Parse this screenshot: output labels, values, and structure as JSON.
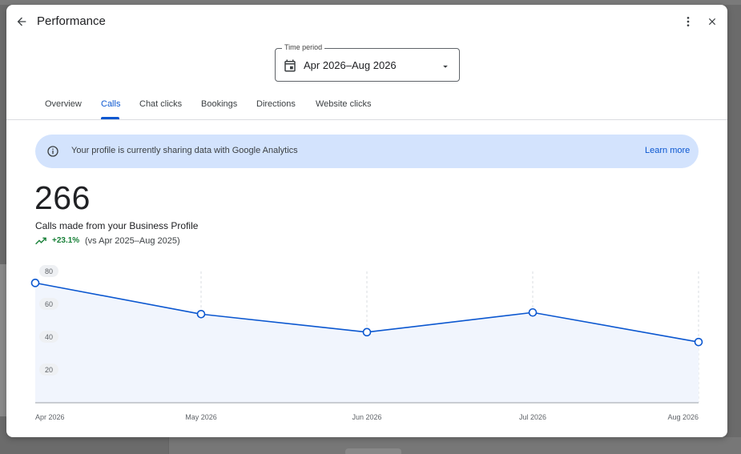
{
  "header": {
    "title": "Performance"
  },
  "time_period": {
    "label": "Time period",
    "value": "Apr 2026–Aug 2026"
  },
  "tabs": [
    {
      "label": "Overview",
      "active": false
    },
    {
      "label": "Calls",
      "active": true
    },
    {
      "label": "Chat clicks",
      "active": false
    },
    {
      "label": "Bookings",
      "active": false
    },
    {
      "label": "Directions",
      "active": false
    },
    {
      "label": "Website clicks",
      "active": false
    }
  ],
  "banner": {
    "text": "Your profile is currently sharing data with Google Analytics",
    "link": "Learn more"
  },
  "metric": {
    "value": "266",
    "description": "Calls made from your Business Profile",
    "change": "+23.1%",
    "comparison": "(vs Apr 2025–Aug 2025)"
  },
  "colors": {
    "accent": "#0b57d0",
    "banner_bg": "#d3e3fd",
    "positive": "#188038",
    "area_fill": "#f1f5fd"
  },
  "chart_data": {
    "type": "area",
    "categories": [
      "Apr 2026",
      "May 2026",
      "Jun 2026",
      "Jul 2026",
      "Aug 2026"
    ],
    "series": [
      {
        "values": [
          73,
          54,
          43,
          55,
          37
        ]
      }
    ],
    "yticks": [
      20,
      40,
      60,
      80
    ],
    "ylim": [
      0,
      80
    ],
    "grid": "vertical-dashed",
    "xlabel": "",
    "ylabel": ""
  }
}
